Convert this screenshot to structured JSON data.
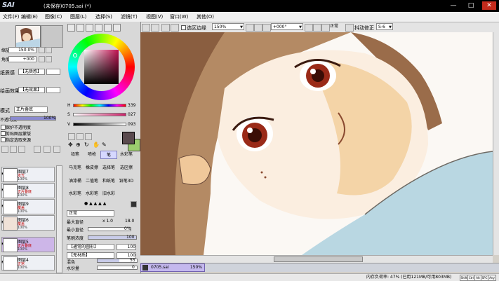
{
  "titlebar": {
    "logo": "SAI",
    "doc_title": "(未保存)0705.sai (*)",
    "min": "—",
    "max": "□",
    "close": "✕"
  },
  "menu": [
    "文件(F)",
    "编辑(E)",
    "图像(C)",
    "图层(L)",
    "选择(S)",
    "滤镜(T)",
    "视图(V)",
    "窗口(W)",
    "其他(O)"
  ],
  "toolbar": {
    "selection_edge_label": "选区边缘",
    "zoom": "150%",
    "rotation": "+000°",
    "mode": "正常",
    "stabilizer_label": "抖动修正",
    "stabilizer_value": "S-6"
  },
  "navigator": {
    "zoom_label": "缩放",
    "zoom_value": "150.0%",
    "angle_label": "角度",
    "angle_value": "+000"
  },
  "layer_props": {
    "texture_label": "纸质感",
    "texture_value": "【无质感】",
    "effect_label": "绘画效果",
    "effect_value": "【无效果】",
    "mode_label": "模式",
    "mode_value": "正片叠底",
    "opacity_label": "不透明度",
    "opacity_value": "100%",
    "options": [
      "保护不透明度",
      "剪贴图层蒙版",
      "指定选取来源"
    ]
  },
  "layers": [
    {
      "name": "图层7",
      "mode": "发光",
      "opacity": "100%"
    },
    {
      "name": "图层8",
      "mode": "正片叠底",
      "opacity": "100%"
    },
    {
      "name": "图层9",
      "mode": "覆盖",
      "opacity": "100%"
    },
    {
      "name": "图层6",
      "mode": "覆盖",
      "opacity": "100%"
    },
    {
      "name": "图层5",
      "mode": "正片叠底",
      "opacity": "100%"
    },
    {
      "name": "图层4",
      "mode": "正常",
      "opacity": "100%"
    }
  ],
  "color": {
    "h_label": "H",
    "h_value": "339",
    "s_label": "S",
    "s_value": "027",
    "v_label": "V",
    "v_value": "093",
    "primary": "#5a4a4e",
    "secondary": "#9ccc6e"
  },
  "tools": [
    [
      "铅笔",
      "喷枪",
      "笔",
      "水彩笔"
    ],
    [
      "马克笔",
      "橡皮擦",
      "选择笔",
      "选区擦"
    ],
    [
      "油漆桶",
      "二值笔",
      "和纸笔",
      "铅笔3D"
    ],
    [
      "水彩笔",
      "水彩笔",
      "旧水彩",
      ""
    ]
  ],
  "brush": {
    "blend_mode": "正常",
    "size_label": "最大直径",
    "size_mult": "x 1.0",
    "size_value": "18.0",
    "min_size_label": "最小直径",
    "min_size_value": "0%",
    "density_label": "笔刷浓度",
    "density_value": "100",
    "shape_value": "【通常的圆形】",
    "shape_num": "100",
    "texture_value": "【无材质】",
    "texture_num": "100",
    "blend_label": "混色",
    "blend_value": "55",
    "water_label": "水份量",
    "water_value": "0"
  },
  "doc_tab": {
    "name": "0705.sai",
    "zoom": "150%"
  },
  "status": {
    "memory": "内存负荷率: 47% (已用121MB/可用803MB)",
    "keys": [
      "Shift",
      "Ctrl",
      "Alt",
      "SPC",
      "Any"
    ]
  }
}
